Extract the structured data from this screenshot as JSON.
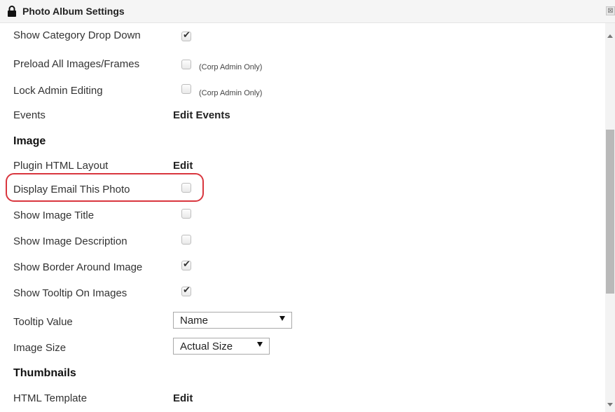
{
  "window": {
    "title": "Photo Album Settings",
    "close_glyph": "⊠"
  },
  "album": {
    "show_category_drop_down": {
      "label": "Show Category Drop Down",
      "checked": true
    },
    "preload_all_images": {
      "label": "Preload All Images/Frames",
      "checked": false,
      "note": "(Corp Admin Only)"
    },
    "lock_admin_editing": {
      "label": "Lock Admin Editing",
      "checked": false,
      "note": "(Corp Admin Only)"
    },
    "events": {
      "label": "Events",
      "link": "Edit Events"
    }
  },
  "image_section": {
    "heading": "Image",
    "plugin_html_layout": {
      "label": "Plugin HTML Layout",
      "link": "Edit"
    },
    "display_email": {
      "label": "Display Email This Photo",
      "checked": false
    },
    "show_image_title": {
      "label": "Show Image Title",
      "checked": false
    },
    "show_image_description": {
      "label": "Show Image Description",
      "checked": false
    },
    "show_border": {
      "label": "Show Border Around Image",
      "checked": true
    },
    "show_tooltip": {
      "label": "Show Tooltip On Images",
      "checked": true
    },
    "tooltip_value": {
      "label": "Tooltip Value",
      "selected": "Name"
    },
    "image_size": {
      "label": "Image Size",
      "selected": "Actual Size"
    }
  },
  "thumbnails_section": {
    "heading": "Thumbnails",
    "html_template": {
      "label": "HTML Template",
      "link": "Edit"
    }
  },
  "glyphs": {
    "check": "✔"
  },
  "colors": {
    "highlight": "#d9363e"
  }
}
